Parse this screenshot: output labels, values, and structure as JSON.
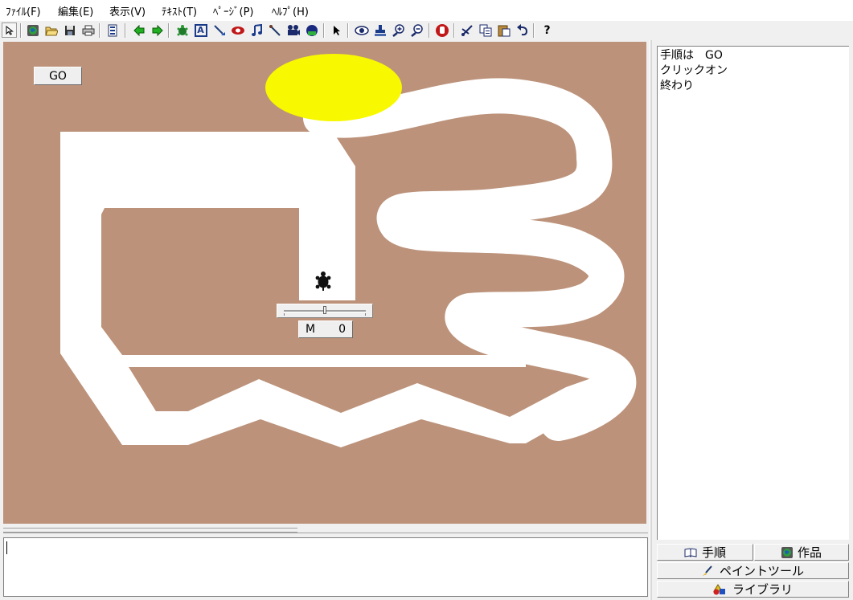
{
  "menu": {
    "items": [
      "ﾌｧｲﾙ(F)",
      "編集(E)",
      "表示(V)",
      "ﾃｷｽﾄ(T)",
      "ﾍﾟｰｼﾞ(P)",
      "ﾍﾙﾌﾟ(H)"
    ]
  },
  "toolbar": {
    "icons": [
      "pointer-icon",
      "globe-icon",
      "open-folder-icon",
      "save-icon",
      "print-icon",
      "page-icon",
      "back-arrow-icon",
      "forward-arrow-icon",
      "turtle-icon",
      "text-icon",
      "paint-icon",
      "eye-oval-icon",
      "music-icon",
      "pencil-icon",
      "camera-icon",
      "video-icon",
      "select-arrow-icon",
      "view-icon",
      "stamp-icon",
      "zoom-in-icon",
      "zoom-out-icon",
      "stop-icon",
      "cut-icon",
      "copy-icon",
      "paste-icon",
      "undo-icon",
      "help-icon"
    ],
    "help_label": "?",
    "text_label": "A"
  },
  "canvas": {
    "go_button": "GO",
    "slider_value": 0.5,
    "meter_label": "M",
    "meter_value": "0",
    "colors": {
      "background": "#bc927a",
      "track": "#ffffff",
      "goal": "#f8f800",
      "turtle": "#111111"
    }
  },
  "procedure": {
    "lines": [
      "手順は　GO",
      "クリックオン",
      "終わり"
    ]
  },
  "tabs": {
    "procedure": "手順",
    "works": "作品",
    "paint_tool": "ペイントツール",
    "library": "ライブラリ"
  },
  "message": {
    "text": ""
  }
}
